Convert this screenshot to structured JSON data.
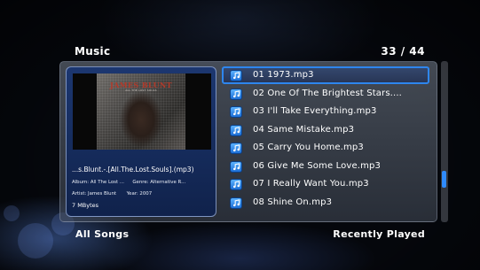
{
  "header": {
    "title": "Music",
    "count": "33 / 44"
  },
  "now_playing": {
    "cover_artist": "JAMES BLUNT",
    "cover_album": "ALL THE LOST SOULS",
    "file": "...s.Blunt.-.[All.The.Lost.Souls].(mp3)",
    "album_label": "Album:",
    "album_value": "All The Lost ...",
    "genre_label": "Genre:",
    "genre_value": "Alternative R...",
    "artist_label": "Artist:",
    "artist_value": "James Blunt",
    "year_label": "Year:",
    "year_value": "2007",
    "size": "7 MBytes"
  },
  "tracks": [
    {
      "label": "01 1973.mp3",
      "icon": "music-file-icon"
    },
    {
      "label": "02 One Of The Brightest Stars....",
      "icon": "music-file-icon"
    },
    {
      "label": "03 I'll Take Everything.mp3",
      "icon": "music-file-icon"
    },
    {
      "label": "04 Same Mistake.mp3",
      "icon": "music-file-icon"
    },
    {
      "label": "05 Carry You Home.mp3",
      "icon": "music-file-icon"
    },
    {
      "label": "06 Give Me Some Love.mp3",
      "icon": "music-file-icon"
    },
    {
      "label": "07 I Really Want You.mp3",
      "icon": "music-file-icon"
    },
    {
      "label": "08 Shine On.mp3",
      "icon": "music-file-icon"
    }
  ],
  "selected_index": 0,
  "scrollbar": {
    "position_fraction": 0.76
  },
  "footer": {
    "left": "All Songs",
    "right": "Recently Played"
  },
  "colors": {
    "accent": "#2e86ee",
    "card_bg": "#1c3770",
    "background": "#05070c"
  }
}
